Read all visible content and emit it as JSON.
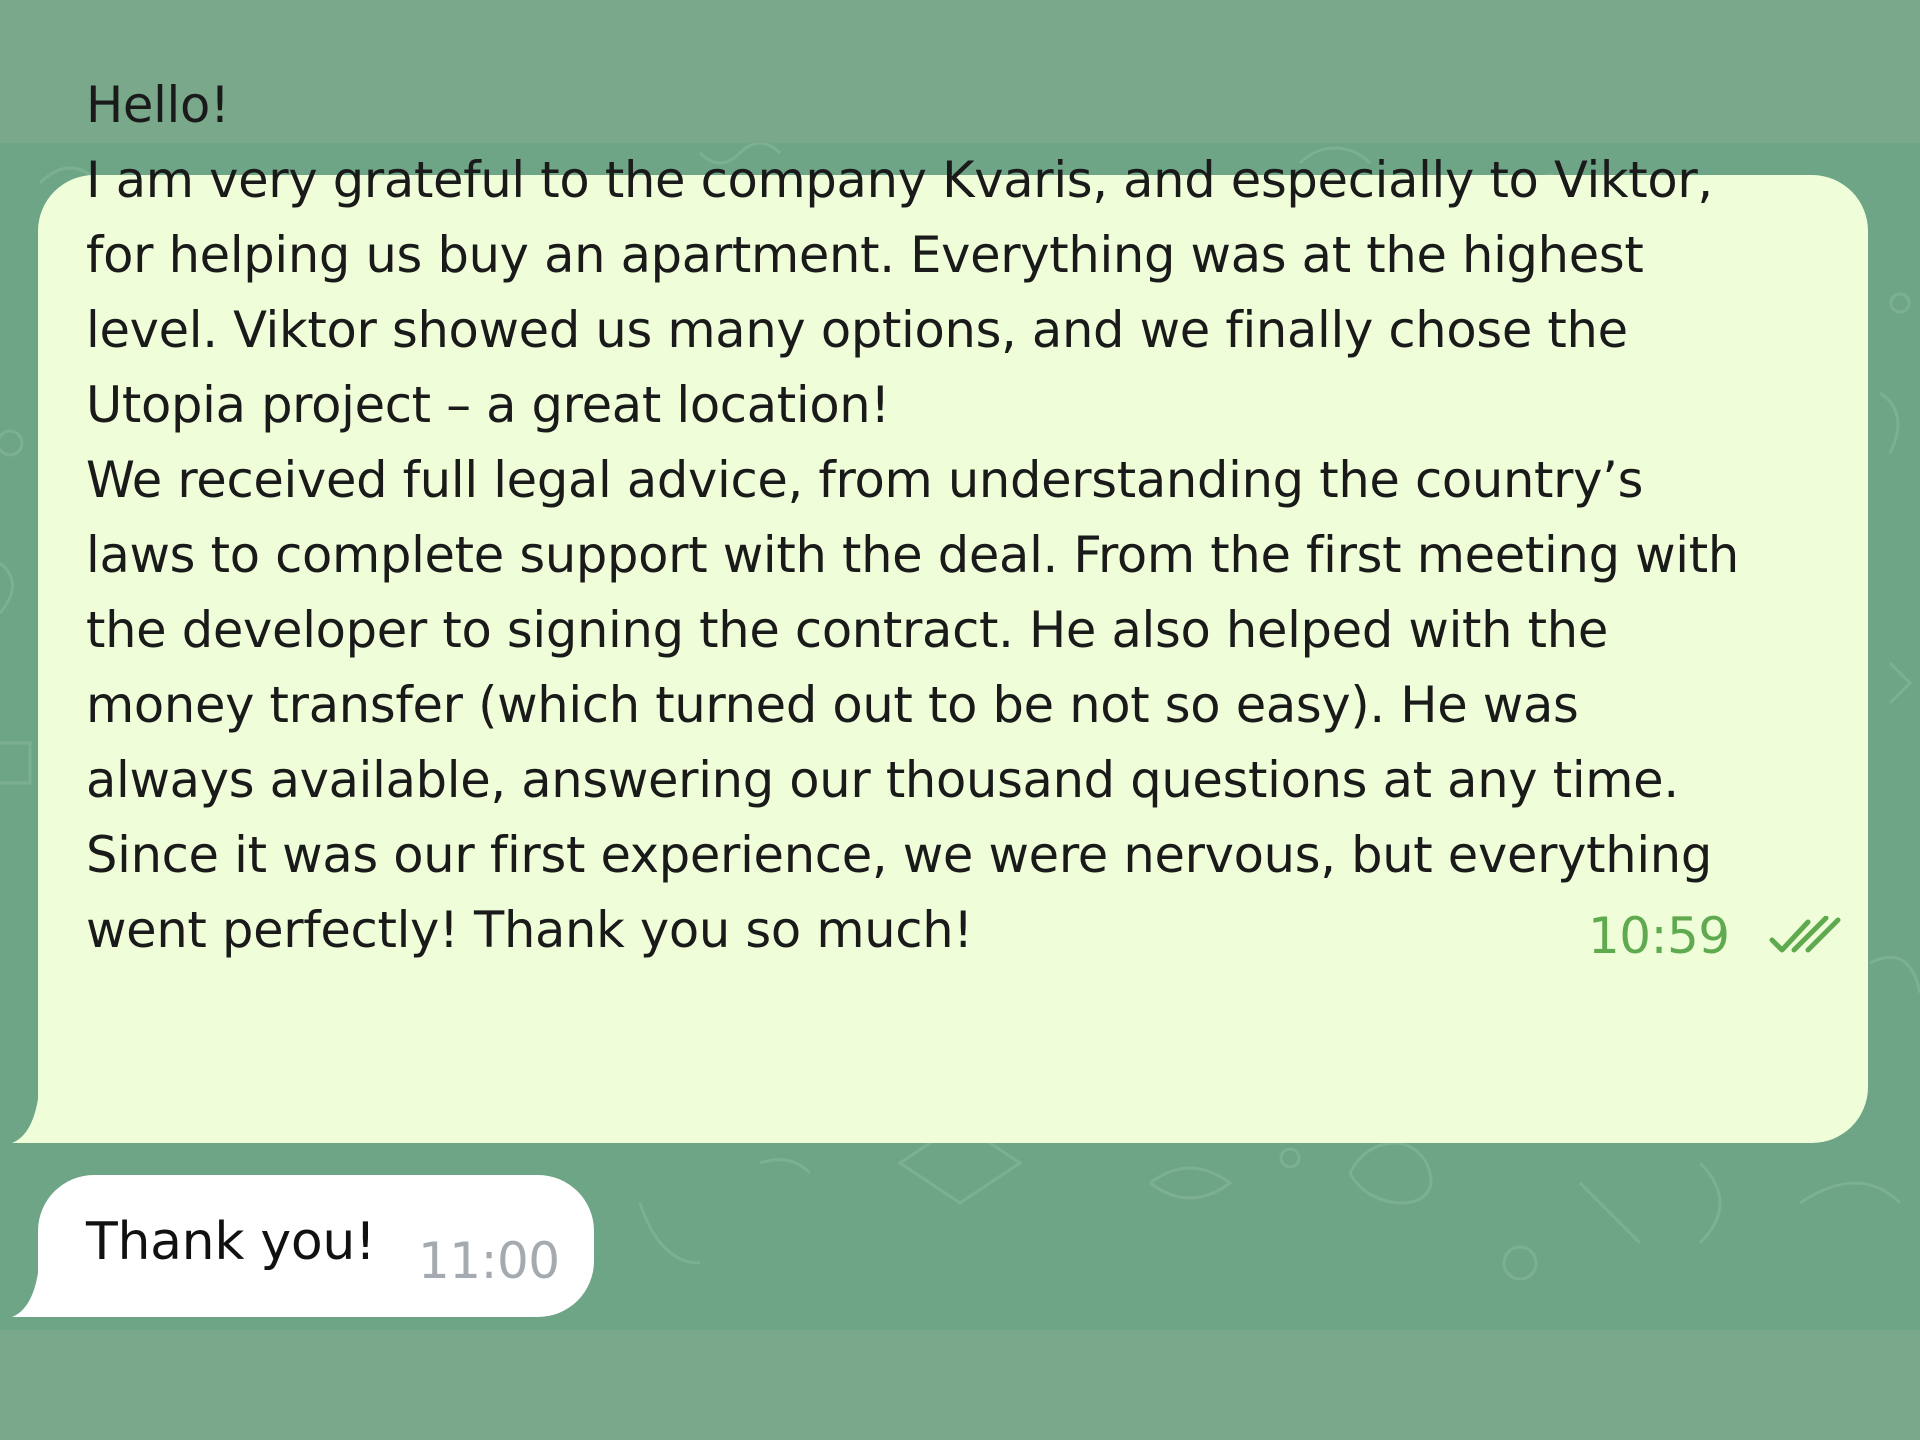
{
  "colors": {
    "backdrop": "#79a98a",
    "chat_background": "#6da586",
    "outgoing_bubble": "#effed9",
    "incoming_bubble": "#ffffff",
    "read_time": "#5fa94f",
    "incoming_time": "#a4aab0"
  },
  "messages": {
    "outgoing": {
      "text": "Hello!\nI am very grateful to the company Kvaris, and especially to Viktor,\nfor helping us buy an apartment. Everything was at the highest\nlevel. Viktor showed us many options, and we finally chose the\nUtopia project – a great location!\nWe received full legal advice, from understanding the country’s\nlaws to complete support with the deal. From the first meeting with\nthe developer to signing the contract. He also helped with the\nmoney transfer (which turned out to be not so easy). He was\nalways available, answering our thousand questions at any time.\nSince it was our first experience, we were nervous, but everything\nwent perfectly! Thank you so much!",
      "time": "10:59",
      "status_icon": "double-check-icon"
    },
    "incoming": {
      "text": "Thank you!",
      "time": "11:00"
    }
  }
}
